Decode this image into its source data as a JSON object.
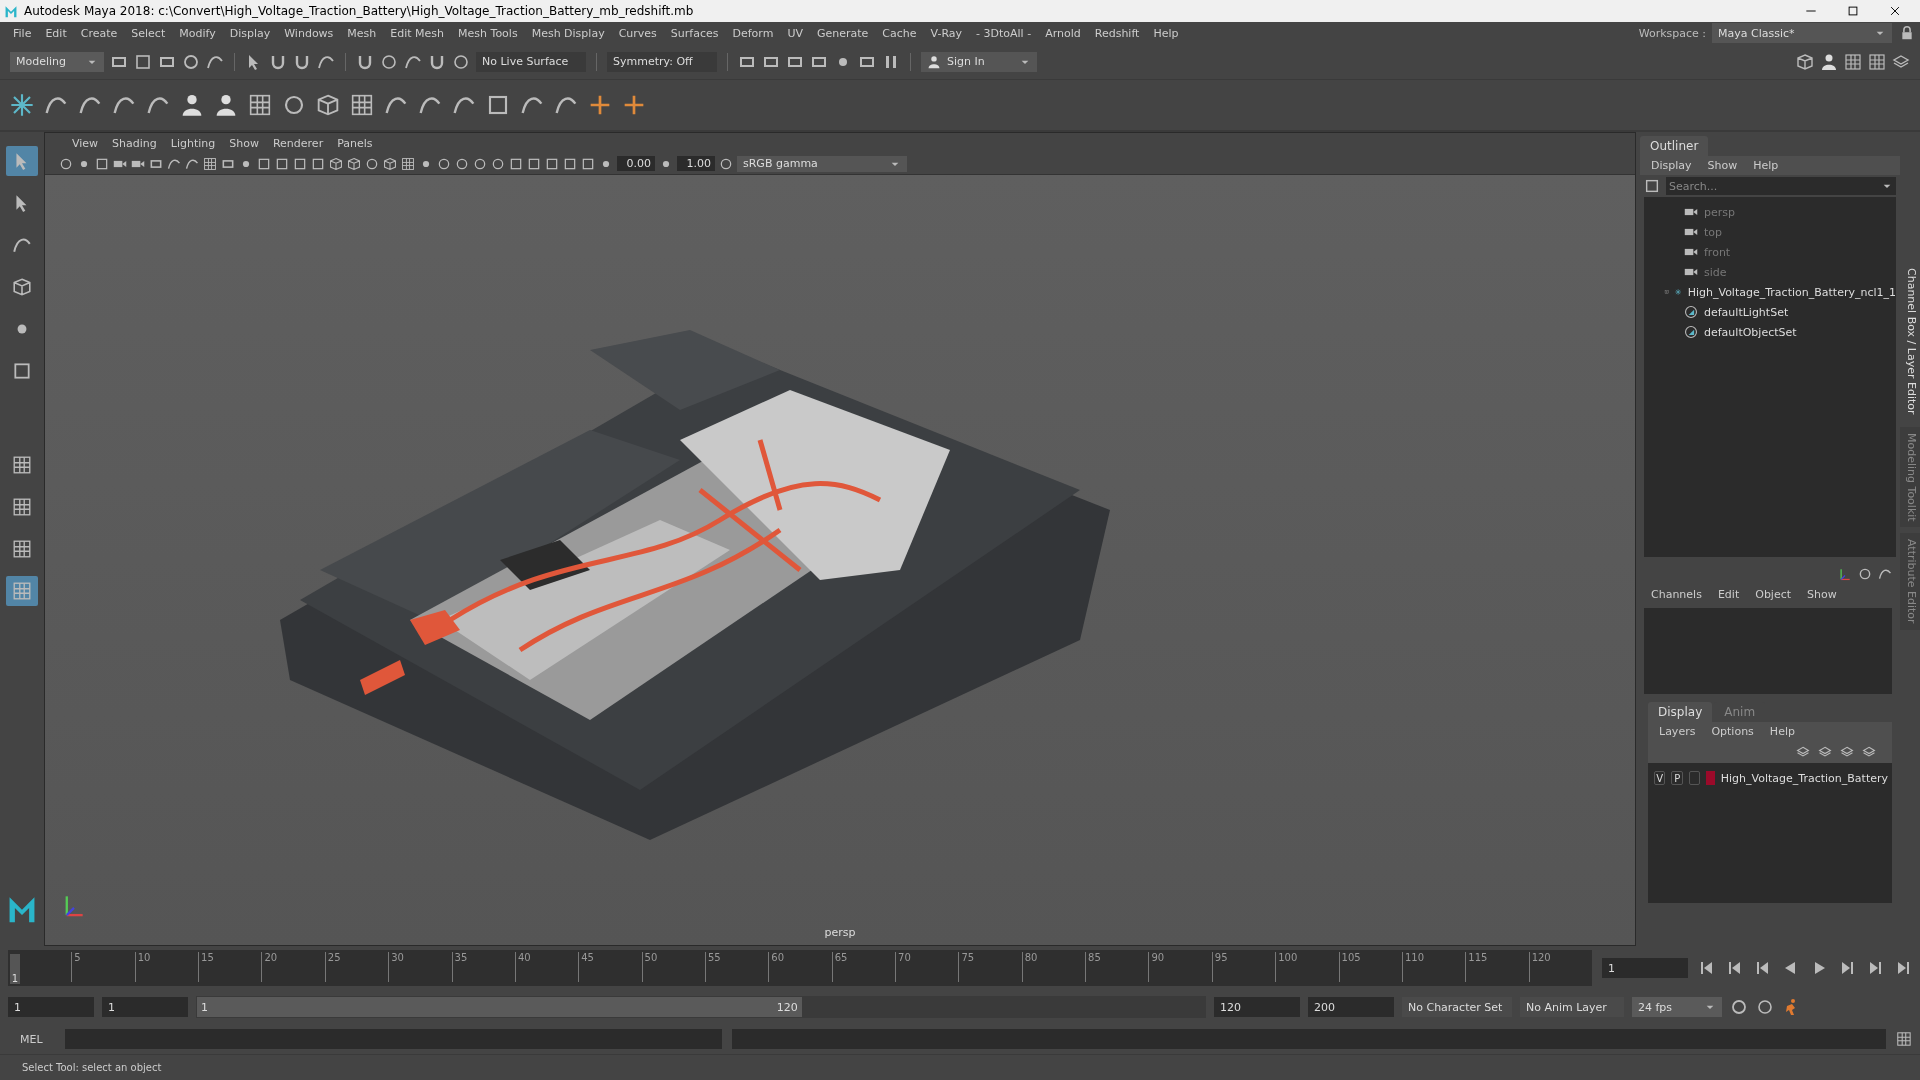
{
  "window": {
    "title": "Autodesk Maya 2018: c:\\Convert\\High_Voltage_Traction_Battery\\High_Voltage_Traction_Battery_mb_redshift.mb"
  },
  "menu_bar": [
    "File",
    "Edit",
    "Create",
    "Select",
    "Modify",
    "Display",
    "Windows",
    "Mesh",
    "Edit Mesh",
    "Mesh Tools",
    "Mesh Display",
    "Curves",
    "Surfaces",
    "Deform",
    "UV",
    "Generate",
    "Cache",
    "V-Ray",
    "- 3DtoAll -",
    "Arnold",
    "Redshift",
    "Help"
  ],
  "workspace": {
    "label": "Workspace :",
    "value": "Maya Classic*"
  },
  "status_line": {
    "mode": "Modeling",
    "live_surface": "No Live Surface",
    "symmetry": "Symmetry: Off",
    "sign_in": "Sign In"
  },
  "viewport": {
    "menus": [
      "View",
      "Shading",
      "Lighting",
      "Show",
      "Renderer",
      "Panels"
    ],
    "exposure": "0.00",
    "gamma": "1.00",
    "color_space": "sRGB gamma",
    "camera_label": "persp"
  },
  "outliner": {
    "title": "Outliner",
    "menus": [
      "Display",
      "Show",
      "Help"
    ],
    "search_placeholder": "Search...",
    "items": [
      {
        "label": "persp",
        "kind": "camera",
        "dimmed": true
      },
      {
        "label": "top",
        "kind": "camera",
        "dimmed": true
      },
      {
        "label": "front",
        "kind": "camera",
        "dimmed": true
      },
      {
        "label": "side",
        "kind": "camera",
        "dimmed": true
      },
      {
        "label": "High_Voltage_Traction_Battery_ncl1_1",
        "kind": "group",
        "dimmed": false,
        "expanded": false
      },
      {
        "label": "defaultLightSet",
        "kind": "set",
        "dimmed": false
      },
      {
        "label": "defaultObjectSet",
        "kind": "set",
        "dimmed": false
      }
    ]
  },
  "channel_box": {
    "menus": [
      "Channels",
      "Edit",
      "Object",
      "Show"
    ]
  },
  "layer_editor": {
    "tabs": [
      {
        "label": "Display",
        "selected": true
      },
      {
        "label": "Anim",
        "selected": false
      }
    ],
    "menus": [
      "Layers",
      "Options",
      "Help"
    ],
    "layers": [
      {
        "visible": "V",
        "playback": "P",
        "color": "#9b0a2a",
        "name": "High_Voltage_Traction_Battery"
      }
    ]
  },
  "side_tabs": [
    {
      "label": "Channel Box / Layer Editor",
      "selected": true
    },
    {
      "label": "Modeling Toolkit",
      "selected": false
    },
    {
      "label": "Attribute Editor",
      "selected": false
    }
  ],
  "timeline": {
    "ticks": [
      "5",
      "10",
      "15",
      "20",
      "25",
      "30",
      "35",
      "40",
      "45",
      "50",
      "55",
      "60",
      "65",
      "70",
      "75",
      "80",
      "85",
      "90",
      "95",
      "100",
      "105",
      "110",
      "115",
      "120"
    ],
    "current_frame": "1",
    "level": 0,
    "frame_field": "1"
  },
  "range": {
    "start": "1",
    "min": "1",
    "slider_start": "1",
    "slider_end": "120",
    "level": 0.6,
    "end": "120",
    "max": "200",
    "character_set": "No Character Set",
    "anim_layer": "No Anim Layer",
    "fps": "24 fps"
  },
  "command_line": {
    "language": "MEL"
  },
  "help_line": "Select Tool: select an object"
}
